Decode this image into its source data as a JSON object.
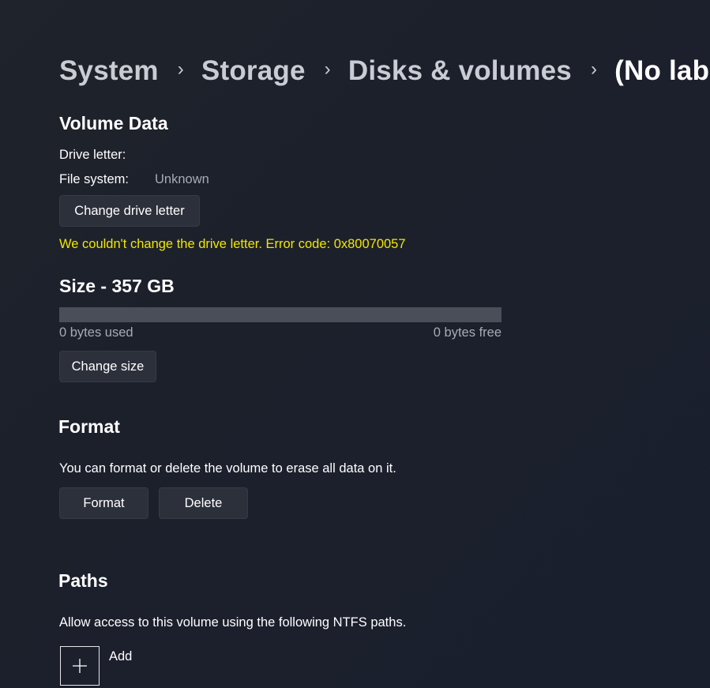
{
  "breadcrumb": {
    "items": [
      "System",
      "Storage",
      "Disks & volumes",
      "(No label)"
    ],
    "separator": "›"
  },
  "volume_data": {
    "title": "Volume Data",
    "drive_letter_label": "Drive letter:",
    "drive_letter_value": "",
    "file_system_label": "File system:",
    "file_system_value": "Unknown",
    "change_drive_letter_button": "Change drive letter",
    "error_message": "We couldn't change the drive letter. Error code: 0x80070057"
  },
  "size": {
    "title": "Size - 357 GB",
    "used_fraction": 0,
    "used_label": "0 bytes used",
    "free_label": "0 bytes free",
    "change_size_button": "Change size"
  },
  "format": {
    "title": "Format",
    "description": "You can format or delete the volume to erase all data on it.",
    "format_button": "Format",
    "delete_button": "Delete"
  },
  "paths": {
    "title": "Paths",
    "description": "Allow access to this volume using the following NTFS paths.",
    "add_icon": "plus-icon",
    "add_label": "Add"
  },
  "colors": {
    "error": "#f2e600",
    "button_bg": "#2c303a",
    "bar_bg": "#4a4e58"
  }
}
